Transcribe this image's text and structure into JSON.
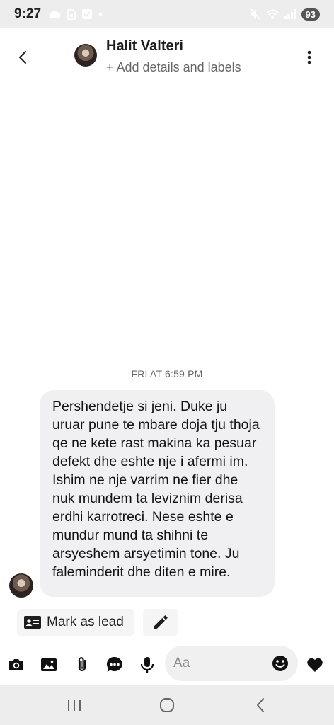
{
  "status_bar": {
    "time": "9:27",
    "battery": "93",
    "icons": [
      "cloud-icon",
      "sim-icon",
      "checkbox-icon",
      "dot-icon",
      "mute-icon",
      "wifi-icon",
      "signal-icon"
    ]
  },
  "header": {
    "contact_name": "Halit Valteri",
    "add_details": "+ Add details and labels",
    "icons": [
      "back-icon",
      "more-vertical-icon"
    ]
  },
  "conversation": {
    "timestamp": "FRI AT 6:59 PM",
    "messages": [
      {
        "text": "Pershendetje si jeni. Duke ju uruar pune te mbare doja tju thoja qe ne kete rast makina ka pesuar defekt dhe eshte nje i afermi im. Ishim ne nje varrim ne fier dhe nuk mundem ta leviznim derisa erdhi karrotreci. Nese eshte e mundur mund ta shihni te arsyeshem arsyetimin tone. Ju faleminderit dhe diten e mire."
      }
    ]
  },
  "quick_actions": {
    "mark_as_lead": "Mark as lead",
    "icons": [
      "contact-card-icon",
      "pencil-icon"
    ]
  },
  "composer": {
    "placeholder": "Aa",
    "icons": [
      "camera-icon",
      "gallery-icon",
      "attachment-icon",
      "chat-bubble-icon",
      "microphone-icon",
      "emoji-icon",
      "heart-icon"
    ]
  },
  "colors": {
    "status_bar_bg": "#ededed",
    "bubble_bg": "#f0f0f3",
    "text_primary": "#1c1e21",
    "text_secondary": "#65676b",
    "icon_dark": "#111111"
  }
}
